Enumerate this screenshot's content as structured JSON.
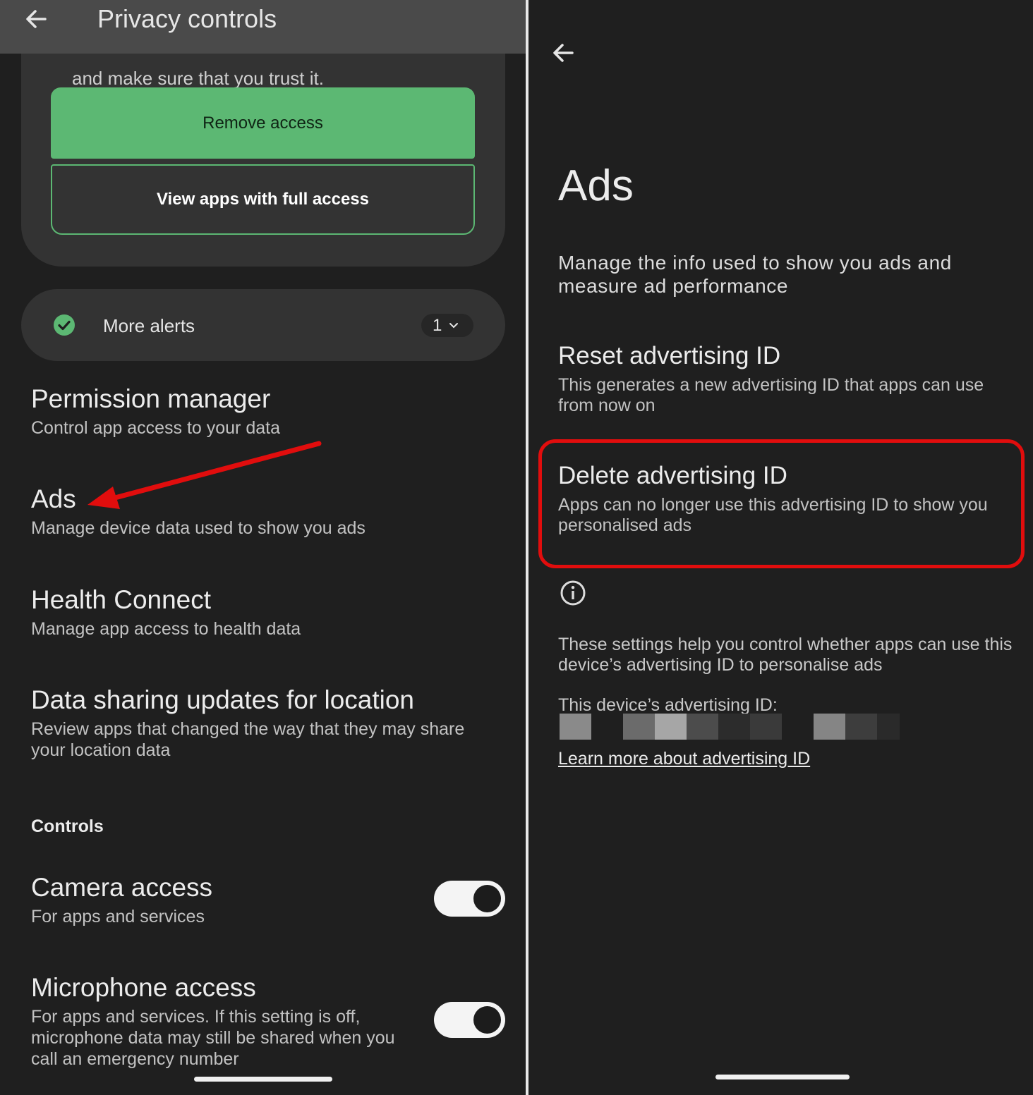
{
  "left": {
    "topbar": {
      "title": "Privacy controls"
    },
    "card": {
      "partial_text": "and make sure that you trust it.",
      "remove_label": "Remove access",
      "view_label": "View apps with full access"
    },
    "alerts": {
      "label": "More alerts",
      "count": "1"
    },
    "items": [
      {
        "title": "Permission manager",
        "subtitle": "Control app access to your data"
      },
      {
        "title": "Ads",
        "subtitle": "Manage device data used to show you ads"
      },
      {
        "title": "Health Connect",
        "subtitle": "Manage app access to health data"
      },
      {
        "title": "Data sharing updates for location",
        "subtitle": "Review apps that changed the way that they may share your location data"
      }
    ],
    "controls_label": "Controls",
    "toggles": [
      {
        "title": "Camera access",
        "subtitle": "For apps and services",
        "state": "on"
      },
      {
        "title": "Microphone access",
        "subtitle": "For apps and services. If this setting is off, microphone data may still be shared when you call an emergency number",
        "state": "on"
      }
    ],
    "annotation_color": "#e10d0d"
  },
  "right": {
    "title": "Ads",
    "description": "Manage the info used to show you ads and measure ad performance",
    "items": [
      {
        "title": "Reset advertising ID",
        "subtitle": "This generates a new advertising ID that apps can use from now on"
      },
      {
        "title": "Delete advertising ID",
        "subtitle": "Apps can no longer use this advertising ID to show you personalised ads"
      }
    ],
    "footnote": "These settings help you control whether apps can use this device’s advertising ID to personalise ads",
    "adid_label": "This device’s advertising ID:",
    "adid_value_note": "pixelated",
    "learn_more": "Learn more about advertising ID",
    "highlight_color": "#e10d0d"
  },
  "colors": {
    "background": "#1f1f1f",
    "surface": "#333333",
    "accent_green": "#5cb873",
    "topbar": "#4a4a4a"
  }
}
